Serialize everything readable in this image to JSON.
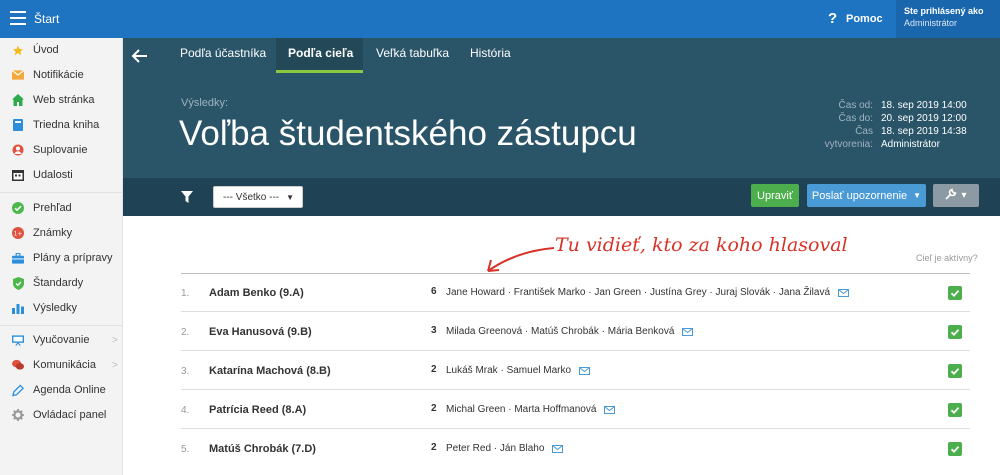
{
  "topbar": {
    "title": "Štart",
    "help_label": "Pomoc",
    "help_icon": "?",
    "user_line1": "Ste prihlásený ako",
    "user_line2": "Administrátor"
  },
  "sidebar": {
    "items": [
      {
        "label": "Úvod",
        "icon": "star-icon",
        "color": "#f2b91b"
      },
      {
        "label": "Notifikácie",
        "icon": "envelope-icon",
        "color": "#f2a83a"
      },
      {
        "label": "Web stránka",
        "icon": "home-icon",
        "color": "#2eaa4a"
      },
      {
        "label": "Triedna kniha",
        "icon": "book-icon",
        "color": "#2d8fdc"
      },
      {
        "label": "Suplovanie",
        "icon": "lifebuoy-icon",
        "color": "#e0523f"
      },
      {
        "label": "Udalosti",
        "icon": "calendar-icon",
        "color": "#333333"
      },
      {
        "label": "Prehľad",
        "icon": "check-circle-icon",
        "color": "#4cb84c"
      },
      {
        "label": "Známky",
        "icon": "grade-icon",
        "color": "#e0523f"
      },
      {
        "label": "Plány a prípravy",
        "icon": "briefcase-icon",
        "color": "#2d8fdc"
      },
      {
        "label": "Štandardy",
        "icon": "shield-icon",
        "color": "#4cb84c"
      },
      {
        "label": "Výsledky",
        "icon": "bar-chart-icon",
        "color": "#2d8fdc"
      },
      {
        "label": "Vyučovanie",
        "icon": "board-icon",
        "color": "#2d8fdc"
      },
      {
        "label": "Komunikácia",
        "icon": "chat-icon",
        "color": "#e0523f"
      },
      {
        "label": "Agenda Online",
        "icon": "pen-icon",
        "color": "#2d8fdc"
      },
      {
        "label": "Ovládací panel",
        "icon": "gear-icon",
        "color": "#999999"
      }
    ]
  },
  "tabs": [
    {
      "label": "Podľa účastníka"
    },
    {
      "label": "Podľa cieľa"
    },
    {
      "label": "Veľká tabuľka"
    },
    {
      "label": "História"
    }
  ],
  "hero": {
    "results_label": "Výsledky:",
    "title": "Voľba študentského zástupcu",
    "meta_keys": [
      "Čas od:",
      "Čas do:",
      "Čas",
      "vytvorenia:"
    ],
    "meta_vals": [
      "18. sep 2019 14:00",
      "20. sep 2019 12:00",
      "18. sep 2019 14:38",
      "Administrátor"
    ]
  },
  "toolbar": {
    "filter_value": "--- Všetko ---",
    "edit_label": "Upraviť",
    "notify_label": "Poslať upozornenie",
    "notify_caret": "▼",
    "tool_caret": "▾"
  },
  "annotation": "Tu vidieť, kto za koho hlasoval",
  "active_question": "Cieľ je aktívny?",
  "rows": [
    {
      "num": "1.",
      "name": "Adam Benko (9.A)",
      "count": "6",
      "voters": "Jane Howard · František Marko · Jan Green · Justína Grey · Juraj Slovák · Jana Žilavá"
    },
    {
      "num": "2.",
      "name": "Eva Hanusová (9.B)",
      "count": "3",
      "voters": "Milada Greenová · Matúš Chrobák · Mária Benková"
    },
    {
      "num": "3.",
      "name": "Katarína Machová (8.B)",
      "count": "2",
      "voters": "Lukáš Mrak · Samuel Marko"
    },
    {
      "num": "4.",
      "name": "Patrícia Reed (8.A)",
      "count": "2",
      "voters": "Michal Green · Marta Hoffmanová"
    },
    {
      "num": "5.",
      "name": "Matúš Chrobák (7.D)",
      "count": "2",
      "voters": "Peter Red · Ján Blaho"
    }
  ],
  "colors": {
    "topbar": "#1f74c2",
    "hero": "#2a5468",
    "toolbar": "#1f4354",
    "accent_green": "#4cae4c",
    "accent_blue": "#4a9ad6",
    "annotation_red": "#d63328"
  }
}
